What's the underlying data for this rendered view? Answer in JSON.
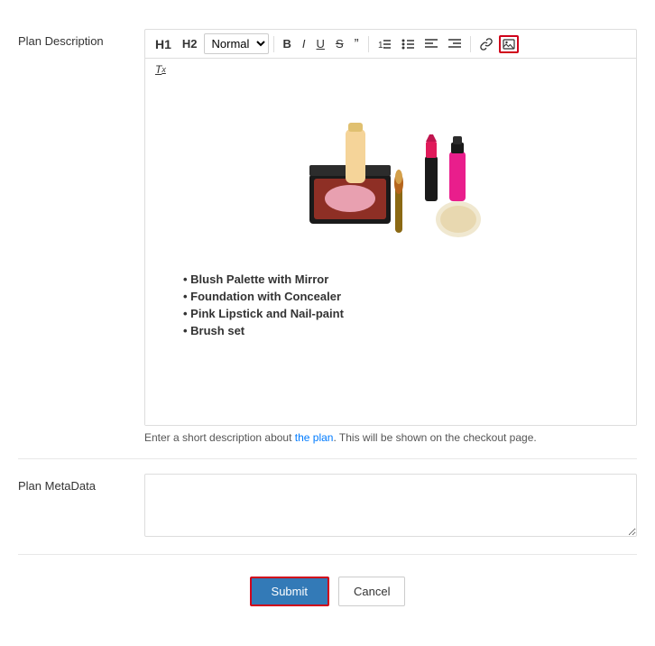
{
  "form": {
    "plan_description_label": "Plan Description",
    "plan_metadata_label": "Plan MetaData",
    "editor_hint": "Enter a short description about the plan. This will be shown on the checkout page.",
    "editor_hint_link": "the plan",
    "metadata_placeholder": "",
    "submit_label": "Submit",
    "cancel_label": "Cancel"
  },
  "toolbar": {
    "h1_label": "H1",
    "h2_label": "H2",
    "format_select": "Normal",
    "bold_label": "B",
    "italic_label": "I",
    "underline_label": "U",
    "strikethrough_label": "S",
    "blockquote_label": "”",
    "ol_label": "ol",
    "ul_label": "ul",
    "align_left_label": "align-left",
    "align_right_label": "align-right",
    "link_label": "link",
    "image_label": "image",
    "clear_format_label": "Tx"
  },
  "bullets": [
    "Blush Palette with Mirror",
    "Foundation with Concealer",
    "Pink Lipstick and Nail-paint",
    "Brush set"
  ]
}
